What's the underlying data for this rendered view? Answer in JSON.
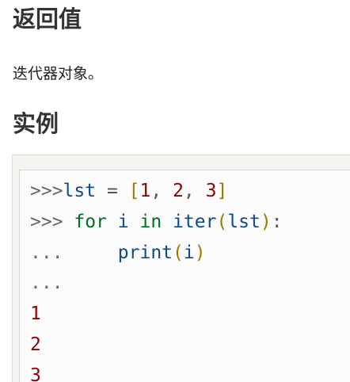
{
  "headings": {
    "return_value": "返回值",
    "example": "实例"
  },
  "description": "迭代器对象。",
  "code": {
    "line1": {
      "prompt": ">>>",
      "var": "lst",
      "assign": " = ",
      "open": "[",
      "n1": "1",
      "sep1": ", ",
      "n2": "2",
      "sep2": ", ",
      "n3": "3",
      "close": "]"
    },
    "line2": {
      "prompt": ">>> ",
      "kw_for": "for",
      "sp1": " ",
      "var_i": "i",
      "sp2": " ",
      "kw_in": "in",
      "sp3": " ",
      "fn": "iter",
      "open": "(",
      "arg": "lst",
      "close": ")",
      "colon": ":"
    },
    "line3": {
      "prompt": "...",
      "indent": "     ",
      "fn": "print",
      "open": "(",
      "arg": "i",
      "close": ")"
    },
    "line4": {
      "prompt": "..."
    },
    "output": [
      "1",
      "2",
      "3"
    ]
  }
}
